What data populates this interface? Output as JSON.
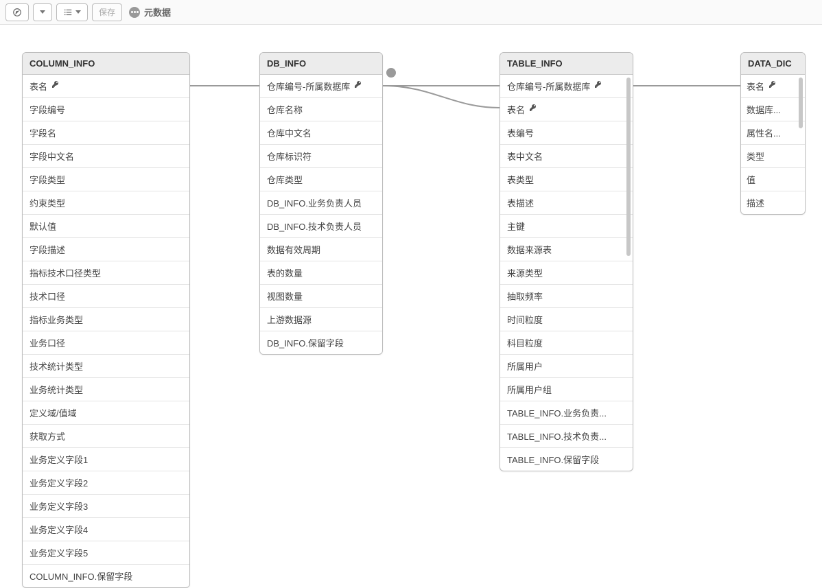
{
  "toolbar": {
    "save_label": "保存",
    "metadata_label": "元数据"
  },
  "tables": {
    "column_info": {
      "title": "COLUMN_INFO",
      "rows": [
        {
          "label": "表名",
          "key": true
        },
        {
          "label": "字段编号"
        },
        {
          "label": "字段名"
        },
        {
          "label": "字段中文名"
        },
        {
          "label": "字段类型"
        },
        {
          "label": "约束类型"
        },
        {
          "label": "默认值"
        },
        {
          "label": "字段描述"
        },
        {
          "label": "指标技术口径类型"
        },
        {
          "label": "技术口径"
        },
        {
          "label": "指标业务类型"
        },
        {
          "label": "业务口径"
        },
        {
          "label": "技术统计类型"
        },
        {
          "label": "业务统计类型"
        },
        {
          "label": "定义域/值域"
        },
        {
          "label": "获取方式"
        },
        {
          "label": "业务定义字段1"
        },
        {
          "label": "业务定义字段2"
        },
        {
          "label": "业务定义字段3"
        },
        {
          "label": "业务定义字段4"
        },
        {
          "label": "业务定义字段5"
        },
        {
          "label": "COLUMN_INFO.保留字段"
        }
      ]
    },
    "db_info": {
      "title": "DB_INFO",
      "rows": [
        {
          "label": "仓库编号-所属数据库",
          "key": true
        },
        {
          "label": "仓库名称"
        },
        {
          "label": "仓库中文名"
        },
        {
          "label": "仓库标识符"
        },
        {
          "label": "仓库类型"
        },
        {
          "label": "DB_INFO.业务负责人员"
        },
        {
          "label": "DB_INFO.技术负责人员"
        },
        {
          "label": "数据有效周期"
        },
        {
          "label": "表的数量"
        },
        {
          "label": "视图数量"
        },
        {
          "label": "上游数据源"
        },
        {
          "label": "DB_INFO.保留字段"
        }
      ]
    },
    "table_info": {
      "title": "TABLE_INFO",
      "rows": [
        {
          "label": "仓库编号-所属数据库",
          "key": true
        },
        {
          "label": "表名",
          "key": true
        },
        {
          "label": "表编号"
        },
        {
          "label": "表中文名"
        },
        {
          "label": "表类型"
        },
        {
          "label": "表描述"
        },
        {
          "label": "主键"
        },
        {
          "label": "数据来源表"
        },
        {
          "label": "来源类型"
        },
        {
          "label": "抽取频率"
        },
        {
          "label": "时间粒度"
        },
        {
          "label": "科目粒度"
        },
        {
          "label": "所属用户"
        },
        {
          "label": "所属用户组"
        },
        {
          "label": "TABLE_INFO.业务负责..."
        },
        {
          "label": "TABLE_INFO.技术负责..."
        },
        {
          "label": "TABLE_INFO.保留字段"
        }
      ]
    },
    "data_dic": {
      "title": "DATA_DIC",
      "rows": [
        {
          "label": "表名",
          "key": true
        },
        {
          "label": "数据库..."
        },
        {
          "label": "属性名..."
        },
        {
          "label": "类型"
        },
        {
          "label": "值"
        },
        {
          "label": "描述"
        }
      ]
    }
  },
  "connections": [
    {
      "from": "column_info.row0.right",
      "to": "db_info.row0.left"
    },
    {
      "from": "db_info.row0.right",
      "to": "table_info.row0.left"
    },
    {
      "from": "db_info.row0.right",
      "to": "table_info.row1.left"
    },
    {
      "from": "table_info.row0.right",
      "to": "data_dic.row0.left"
    }
  ]
}
